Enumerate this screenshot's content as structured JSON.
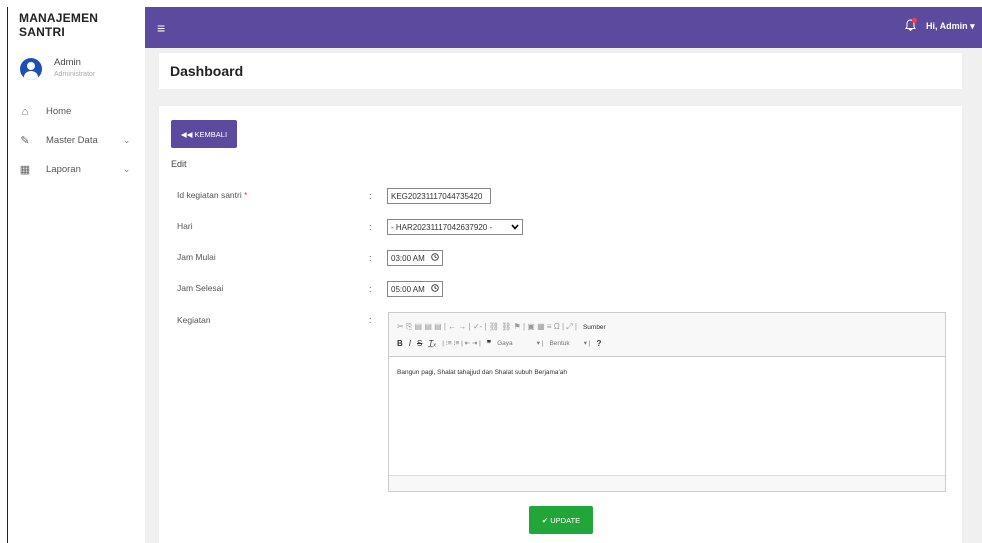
{
  "app": {
    "brand": "MANAJEMEN SANTRI"
  },
  "user": {
    "name": "Admin",
    "role": "Administrator",
    "greeting": "Hi, Admin ▾"
  },
  "sidebar": {
    "items": [
      {
        "label": "Home",
        "icon": "home-icon",
        "glyph": "⌂",
        "chevron": ""
      },
      {
        "label": "Master Data",
        "icon": "edit-icon",
        "glyph": "✎",
        "chevron": "⌄"
      },
      {
        "label": "Laporan",
        "icon": "calendar-icon",
        "glyph": "▦",
        "chevron": "⌄"
      }
    ]
  },
  "topbar": {
    "menu_glyph": "≡",
    "bell_glyph": "🔔"
  },
  "page": {
    "title": "Dashboard"
  },
  "form": {
    "back_label": "◀◀ KEMBALI",
    "section_label": "Edit",
    "fields": {
      "id": {
        "label": "Id kegiatan santri",
        "required": "*",
        "value": "KEG20231117044735420"
      },
      "hari": {
        "label": "Hari",
        "value": "- HAR20231117042637920 -"
      },
      "jam_mulai": {
        "label": "Jam Mulai",
        "value": "03:00 AM"
      },
      "jam_selesai": {
        "label": "Jam Selesai",
        "value": "05:00 AM"
      },
      "kegiatan": {
        "label": "Kegiatan",
        "value": "Bangun pagi, Shalat tahajjud dan Shalat subuh Berjama'ah"
      }
    },
    "colon": ":",
    "editor": {
      "toolbar1": "✂ ⎘ ▤ ▤ ▤ | ← → | ✓- | ⛓ ⛓ ⚑ | ▣ ▦ ≡ Ω | ⤢ |",
      "source_label": "Sumber",
      "gaya_label": "Gaya",
      "bentuk_label": "Bentuk",
      "help": "?"
    },
    "update_label": "✔ UPDATE"
  },
  "colors": {
    "primary": "#5b4a9e",
    "success": "#22a63a"
  }
}
